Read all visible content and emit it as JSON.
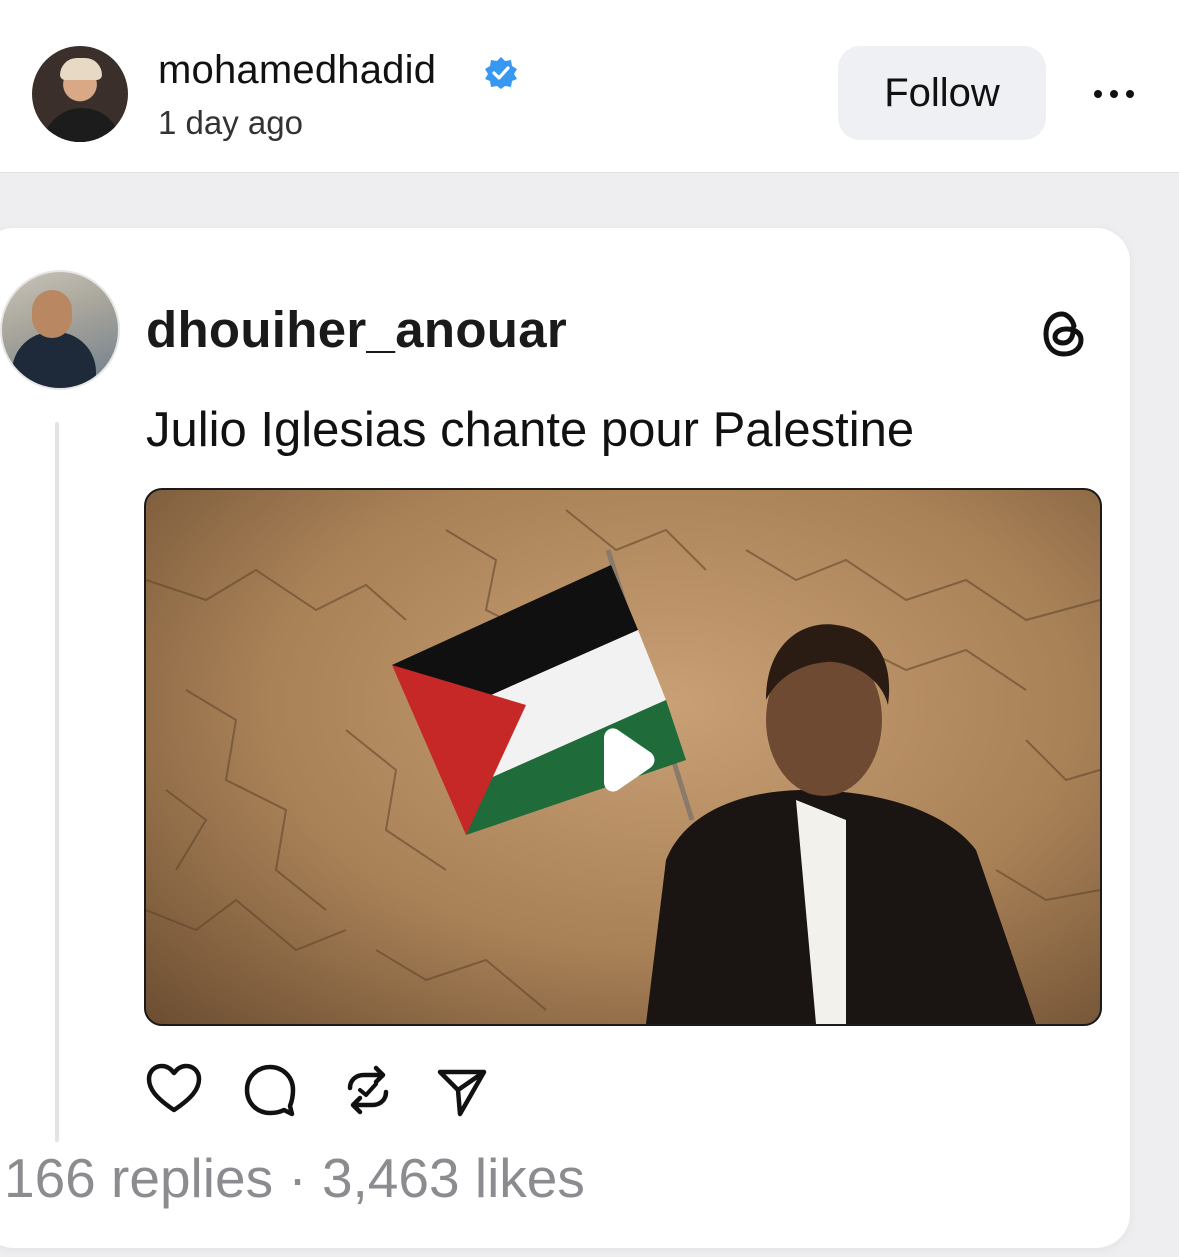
{
  "header": {
    "username": "mohamedhadid",
    "timestamp": "1 day ago",
    "follow_label": "Follow",
    "more_icon": "more-horizontal-icon",
    "verified_icon": "verified-badge-icon",
    "verified_color": "#3897f0"
  },
  "embedded_post": {
    "username": "dhouiher_anouar",
    "brand_icon": "threads-logo-icon",
    "text": "Julio Iglesias chante pour Palestine",
    "media": {
      "type": "video",
      "play_icon": "play-icon"
    },
    "actions": [
      {
        "name": "like",
        "icon": "heart-icon"
      },
      {
        "name": "reply",
        "icon": "comment-icon"
      },
      {
        "name": "repost",
        "icon": "repost-icon"
      },
      {
        "name": "share",
        "icon": "send-icon"
      }
    ],
    "stats": "166 replies · 3,463 likes"
  },
  "colors": {
    "page_bg": "#eeeef0",
    "card_bg": "#ffffff",
    "follow_bg": "#eff0f4",
    "stats_text": "#8c8c90"
  }
}
